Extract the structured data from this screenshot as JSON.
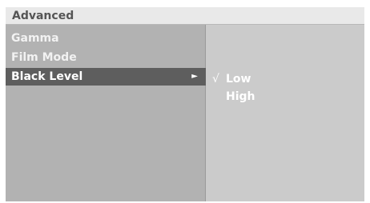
{
  "header": {
    "title": "Advanced"
  },
  "menu": {
    "items": [
      {
        "label": "Gamma",
        "selected": false
      },
      {
        "label": "Film Mode",
        "selected": false
      },
      {
        "label": "Black Level",
        "selected": true,
        "arrow": "►"
      }
    ]
  },
  "submenu": {
    "options": [
      {
        "label": "Low",
        "checked": true,
        "mark": "√"
      },
      {
        "label": "High",
        "checked": false,
        "mark": ""
      }
    ]
  },
  "colors": {
    "header_bg": "#e9e9e9",
    "left_panel_bg": "#b2b2b2",
    "right_panel_bg": "#cbcbcb",
    "selected_bg": "#5e5e5e",
    "text": "#ffffff"
  }
}
